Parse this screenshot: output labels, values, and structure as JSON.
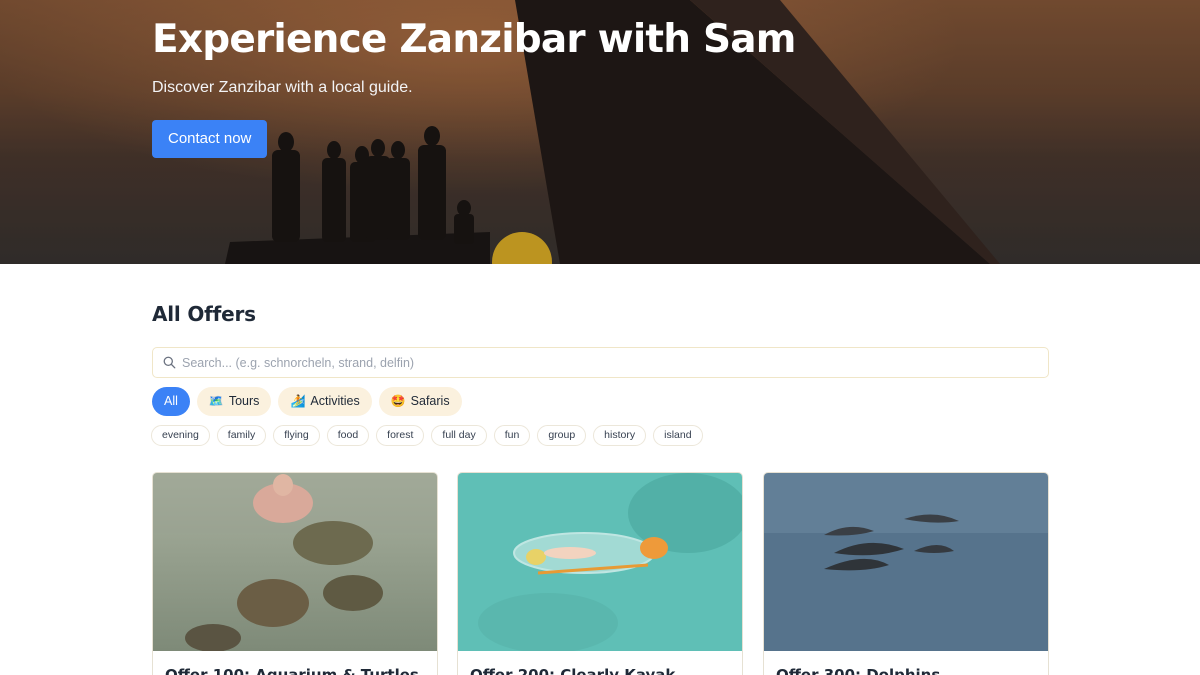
{
  "hero": {
    "title": "Experience Zanzibar with Sam",
    "subtitle": "Discover Zanzibar with a local guide.",
    "cta_label": "Contact now"
  },
  "offers": {
    "title": "All Offers",
    "search": {
      "placeholder": "Search... (e.g. schnorcheln, strand, delfin)",
      "value": ""
    },
    "categories": [
      {
        "label": "All",
        "icon": "",
        "active": true
      },
      {
        "label": "Tours",
        "icon": "🗺️",
        "active": false
      },
      {
        "label": "Activities",
        "icon": "🏄",
        "active": false
      },
      {
        "label": "Safaris",
        "icon": "🤩",
        "active": false
      }
    ],
    "tags": [
      "evening",
      "family",
      "flying",
      "food",
      "forest",
      "full day",
      "fun",
      "group",
      "history",
      "island"
    ],
    "cards": [
      {
        "title": "Offer 100: Aquarium & Turtles",
        "image": "turtles-photo"
      },
      {
        "title": "Offer 200: Clearly Kayak",
        "image": "kayak-photo"
      },
      {
        "title": "Offer 300: Dolphins",
        "image": "dolphins-photo"
      }
    ]
  },
  "colors": {
    "accent": "#3b82f6",
    "pill_bg": "#fbf1de",
    "text": "#1f2937"
  }
}
